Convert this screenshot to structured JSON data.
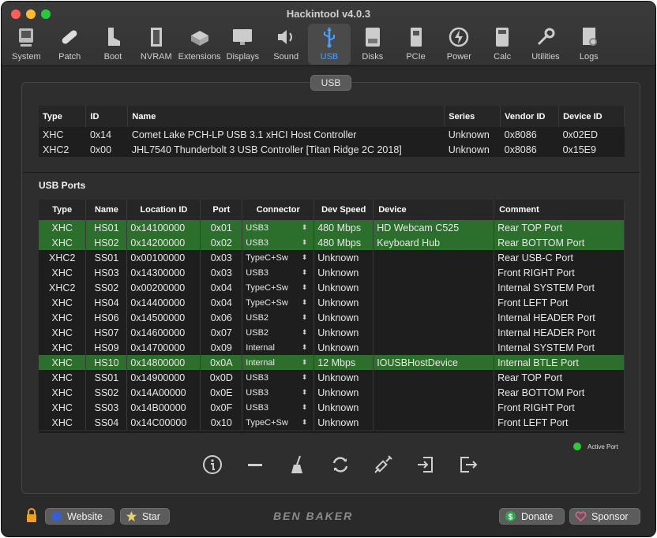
{
  "window": {
    "title": "Hackintool v4.0.3"
  },
  "toolbar": {
    "items": [
      {
        "label": "System",
        "icon": "system-icon"
      },
      {
        "label": "Patch",
        "icon": "patch-icon"
      },
      {
        "label": "Boot",
        "icon": "boot-icon"
      },
      {
        "label": "NVRAM",
        "icon": "nvram-icon"
      },
      {
        "label": "Extensions",
        "icon": "extensions-icon"
      },
      {
        "label": "Displays",
        "icon": "displays-icon"
      },
      {
        "label": "Sound",
        "icon": "sound-icon"
      },
      {
        "label": "USB",
        "icon": "usb-icon",
        "active": true
      },
      {
        "label": "Disks",
        "icon": "disks-icon"
      },
      {
        "label": "PCIe",
        "icon": "pcie-icon"
      },
      {
        "label": "Power",
        "icon": "power-icon"
      },
      {
        "label": "Calc",
        "icon": "calc-icon"
      },
      {
        "label": "Utilities",
        "icon": "utilities-icon"
      },
      {
        "label": "Logs",
        "icon": "logs-icon"
      }
    ]
  },
  "panel": {
    "tab_label": "USB"
  },
  "controllers": {
    "headers": [
      "Type",
      "ID",
      "Name",
      "Series",
      "Vendor ID",
      "Device ID"
    ],
    "rows": [
      [
        "XHC",
        "0x14",
        "Comet Lake PCH-LP USB 3.1 xHCI Host Controller",
        "Unknown",
        "0x8086",
        "0x02ED"
      ],
      [
        "XHC2",
        "0x00",
        "JHL7540 Thunderbolt 3 USB Controller [Titan Ridge 2C 2018]",
        "Unknown",
        "0x8086",
        "0x15E9"
      ]
    ]
  },
  "ports": {
    "label": "USB Ports",
    "headers": [
      "Type",
      "Name",
      "Location ID",
      "Port",
      "Connector",
      "Dev Speed",
      "Device",
      "Comment"
    ],
    "rows": [
      {
        "type": "XHC",
        "name": "HS01",
        "location": "0x14100000",
        "port": "0x01",
        "connector": "USB3",
        "speed": "480 Mbps",
        "device": "HD Webcam C525",
        "comment": "Rear TOP Port",
        "active": true
      },
      {
        "type": "XHC",
        "name": "HS02",
        "location": "0x14200000",
        "port": "0x02",
        "connector": "USB3",
        "speed": "480 Mbps",
        "device": "Keyboard Hub",
        "comment": "Rear BOTTOM Port",
        "active": true
      },
      {
        "type": "XHC2",
        "name": "SS01",
        "location": "0x00100000",
        "port": "0x03",
        "connector": "TypeC+Sw",
        "speed": "Unknown",
        "device": "",
        "comment": "Rear USB-C Port",
        "active": false
      },
      {
        "type": "XHC",
        "name": "HS03",
        "location": "0x14300000",
        "port": "0x03",
        "connector": "USB3",
        "speed": "Unknown",
        "device": "",
        "comment": "Front RIGHT Port",
        "active": false
      },
      {
        "type": "XHC2",
        "name": "SS02",
        "location": "0x00200000",
        "port": "0x04",
        "connector": "TypeC+Sw",
        "speed": "Unknown",
        "device": "",
        "comment": "Internal SYSTEM Port",
        "active": false
      },
      {
        "type": "XHC",
        "name": "HS04",
        "location": "0x14400000",
        "port": "0x04",
        "connector": "TypeC+Sw",
        "speed": "Unknown",
        "device": "",
        "comment": "Front LEFT Port",
        "active": false
      },
      {
        "type": "XHC",
        "name": "HS06",
        "location": "0x14500000",
        "port": "0x06",
        "connector": "USB2",
        "speed": "Unknown",
        "device": "",
        "comment": "Internal HEADER Port",
        "active": false
      },
      {
        "type": "XHC",
        "name": "HS07",
        "location": "0x14600000",
        "port": "0x07",
        "connector": "USB2",
        "speed": "Unknown",
        "device": "",
        "comment": "Internal HEADER Port",
        "active": false
      },
      {
        "type": "XHC",
        "name": "HS09",
        "location": "0x14700000",
        "port": "0x09",
        "connector": "Internal",
        "speed": "Unknown",
        "device": "",
        "comment": "Internal SYSTEM Port",
        "active": false
      },
      {
        "type": "XHC",
        "name": "HS10",
        "location": "0x14800000",
        "port": "0x0A",
        "connector": "Internal",
        "speed": "12 Mbps",
        "device": "IOUSBHostDevice",
        "comment": "Internal BTLE Port",
        "active": true
      },
      {
        "type": "XHC",
        "name": "SS01",
        "location": "0x14900000",
        "port": "0x0D",
        "connector": "USB3",
        "speed": "Unknown",
        "device": "",
        "comment": "Rear TOP Port",
        "active": false
      },
      {
        "type": "XHC",
        "name": "SS02",
        "location": "0x14A00000",
        "port": "0x0E",
        "connector": "USB3",
        "speed": "Unknown",
        "device": "",
        "comment": "Rear BOTTOM Port",
        "active": false
      },
      {
        "type": "XHC",
        "name": "SS03",
        "location": "0x14B00000",
        "port": "0x0F",
        "connector": "USB3",
        "speed": "Unknown",
        "device": "",
        "comment": "Front RIGHT Port",
        "active": false
      },
      {
        "type": "XHC",
        "name": "SS04",
        "location": "0x14C00000",
        "port": "0x10",
        "connector": "TypeC+Sw",
        "speed": "Unknown",
        "device": "",
        "comment": "Front LEFT Port",
        "active": false
      }
    ],
    "legend": "Active Port"
  },
  "actions": [
    "info-icon",
    "remove-icon",
    "clear-icon",
    "refresh-icon",
    "inject-icon",
    "import-icon",
    "export-icon"
  ],
  "bottom": {
    "website_label": "Website",
    "star_label": "Star",
    "brand": "BEN BAKER",
    "donate_label": "Donate",
    "sponsor_label": "Sponsor"
  },
  "colors": {
    "active_row": "#2c6e2c",
    "accent": "#4a9eff",
    "active_dot": "#2dc937"
  }
}
